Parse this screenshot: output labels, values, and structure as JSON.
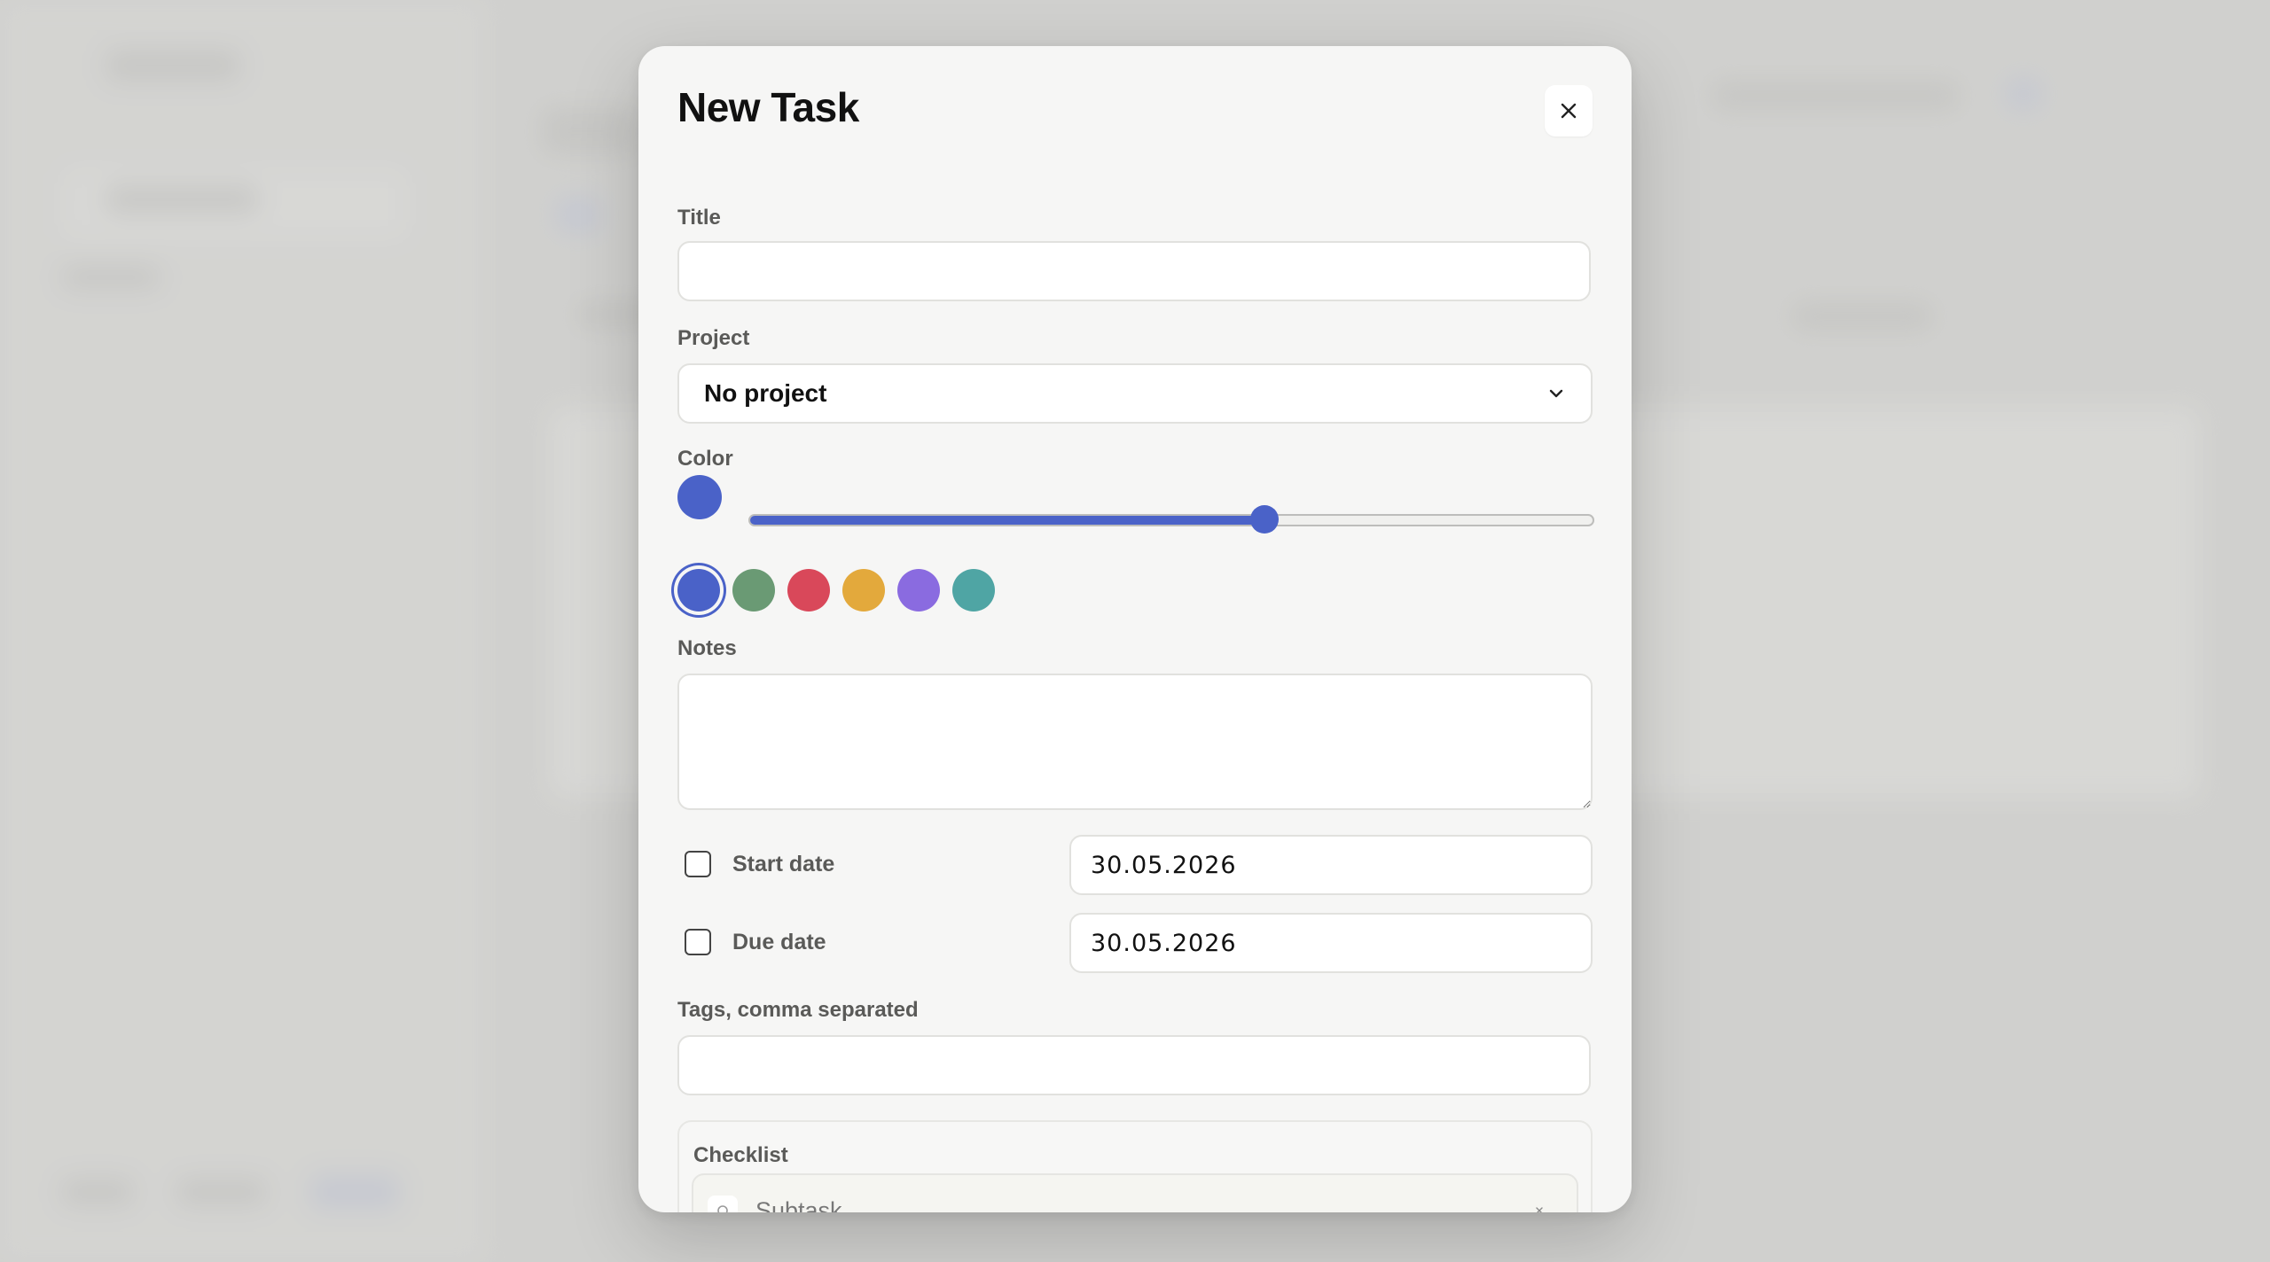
{
  "modal": {
    "title": "New Task",
    "title_label": "Title",
    "title_value": "",
    "project_label": "Project",
    "project_value": "No project",
    "color_label": "Color",
    "color_selected": "#4a62c8",
    "color_slider_fraction": 0.61,
    "swatches": [
      "#4a62c8",
      "#6a9a74",
      "#d9485a",
      "#e3a93c",
      "#8a6be0",
      "#4fa5a4"
    ],
    "notes_label": "Notes",
    "notes_value": "",
    "start_date_label": "Start date",
    "start_date_value": "30.05.2026",
    "start_date_checked": false,
    "due_date_label": "Due date",
    "due_date_value": "30.05.2026",
    "due_date_checked": false,
    "tags_label": "Tags, comma separated",
    "tags_value": "",
    "checklist_title": "Checklist",
    "subtask_placeholder": "Subtask"
  },
  "icons": {
    "close": "close-icon",
    "chevron": "chevron-down-icon",
    "subtask_circle": "circle-icon",
    "subtask_remove": "remove-icon"
  }
}
